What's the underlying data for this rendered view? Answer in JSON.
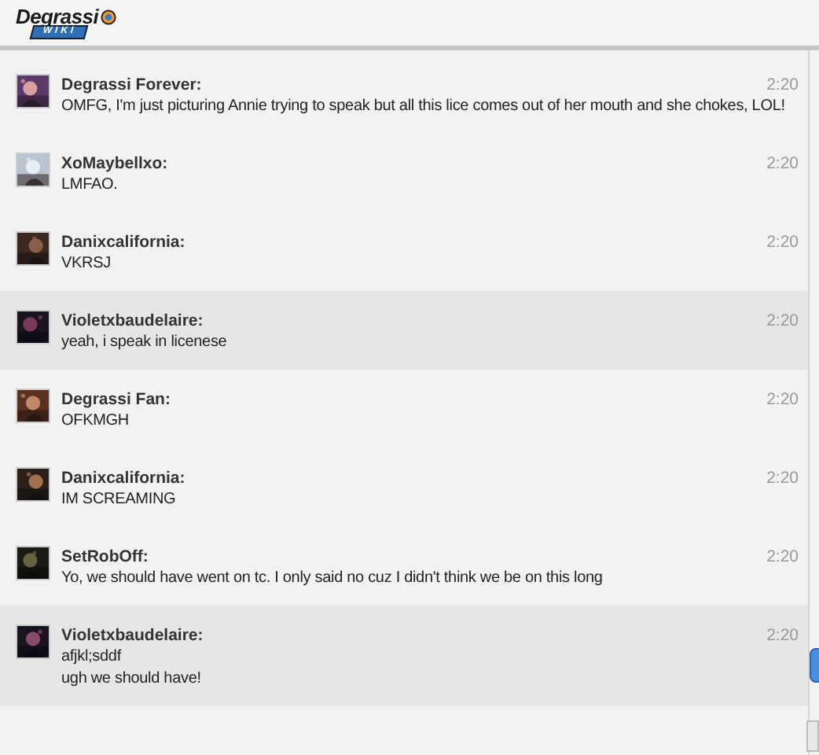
{
  "header": {
    "logo_text": "Degrassi",
    "logo_subtitle": "WIKI"
  },
  "messages": [
    {
      "author": "Degrassi Forever:",
      "time": "2:20",
      "highlighted": false,
      "lines": [
        "OMFG, I'm just picturing Annie trying to speak but all this lice comes out of her mouth and she chokes, LOL!"
      ]
    },
    {
      "author": "XoMaybellxo:",
      "time": "2:20",
      "highlighted": false,
      "lines": [
        "LMFAO."
      ]
    },
    {
      "author": "Danixcalifornia:",
      "time": "2:20",
      "highlighted": false,
      "lines": [
        "VKRSJ"
      ]
    },
    {
      "author": "Violetxbaudelaire:",
      "time": "2:20",
      "highlighted": true,
      "lines": [
        "yeah, i speak in licenese"
      ]
    },
    {
      "author": "Degrassi Fan:",
      "time": "2:20",
      "highlighted": false,
      "lines": [
        "OFKMGH"
      ]
    },
    {
      "author": "Danixcalifornia:",
      "time": "2:20",
      "highlighted": false,
      "lines": [
        "IM SCREAMING"
      ]
    },
    {
      "author": "SetRobOff:",
      "time": "2:20",
      "highlighted": false,
      "lines": [
        "Yo, we should have went on tc. I only said no cuz I didn't think we be on this long"
      ]
    },
    {
      "author": "Violetxbaudelaire:",
      "time": "2:20",
      "highlighted": true,
      "lines": [
        "afjkl;sddf",
        "ugh we should have!"
      ]
    }
  ]
}
